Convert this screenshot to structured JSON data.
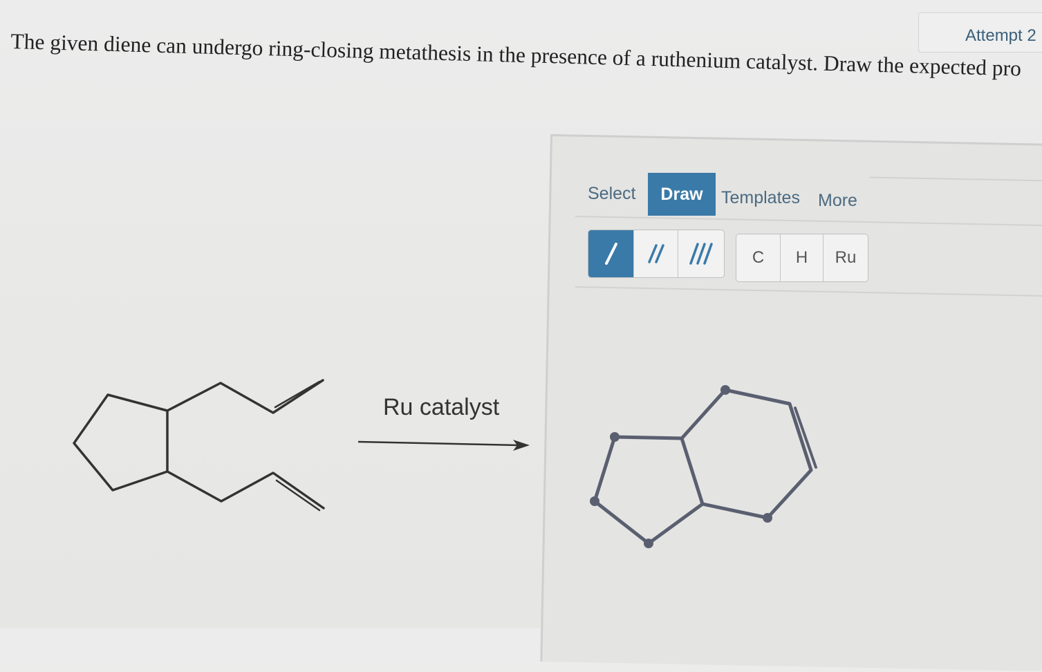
{
  "attempt": {
    "label": "Attempt 2"
  },
  "question": {
    "text": "The given diene can undergo ring-closing metathesis in the presence of a ruthenium catalyst. Draw the expected pro"
  },
  "reaction": {
    "reagent_label": "Ru catalyst"
  },
  "toolbar": {
    "tabs": [
      {
        "label": "Select",
        "active": false
      },
      {
        "label": "Draw",
        "active": true
      },
      {
        "label": "Templates",
        "active": false
      },
      {
        "label": "More",
        "active": false
      }
    ],
    "bond_tools": [
      {
        "icon": "single-bond-icon",
        "active": true
      },
      {
        "icon": "double-bond-icon",
        "active": false
      },
      {
        "icon": "triple-bond-icon",
        "active": false
      }
    ],
    "atom_tools": [
      "C",
      "H",
      "Ru"
    ]
  },
  "colors": {
    "accent": "#3a7aa8",
    "drawn_bond": "#5a5f70",
    "reactant_bond": "#333333"
  }
}
